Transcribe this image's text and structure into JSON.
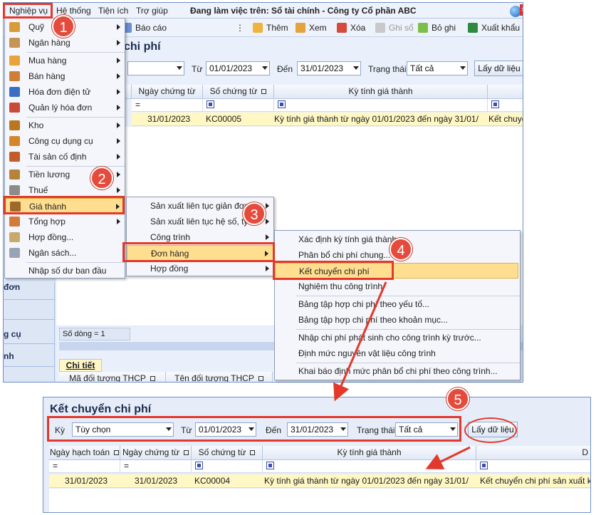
{
  "menubar": {
    "items": [
      "Nghiệp vụ",
      "Hệ thống",
      "Tiện ích",
      "Trợ giúp"
    ],
    "title": "Đang làm việc trên: Sổ tài chính - Công ty Cổ phần ABC"
  },
  "toolbar": {
    "report": "Báo cáo",
    "add": "Thêm",
    "view": "Xem",
    "delete": "Xóa",
    "post": "Ghi sổ",
    "unpost": "Bỏ ghi",
    "export": "Xuất khẩu"
  },
  "left_nav": {
    "items": [
      "đơn",
      "g cụ",
      "nh"
    ]
  },
  "screen_top": {
    "title": "chi phí",
    "from_label": "Từ",
    "from_value": "01/01/2023",
    "to_label": "Đến",
    "to_value": "31/01/2023",
    "status_label": "Trạng thái",
    "status_value": "Tất cả",
    "load_button": "Lấy dữ liệu",
    "columns": [
      "Ngày chứng từ",
      "Số chứng từ",
      "Kỳ tính giá thành"
    ],
    "filter_eq": "=",
    "row": {
      "voucher_date": "31/01/2023",
      "voucher_no": "KC00005",
      "period": "Kỳ tính giá thành từ ngày 01/01/2023 đến ngày 31/01/",
      "desc": "Kết chuyể"
    },
    "row_count": "Số dòng = 1",
    "detail_tab": "Chi tiết",
    "detail_columns": [
      "Mã đối tượng THCP",
      "Tên đối tượng THCP"
    ]
  },
  "menu1": {
    "items": [
      "Quỹ",
      "Ngân hàng",
      "Mua hàng",
      "Bán hàng",
      "Hóa đơn điện tử",
      "Quản lý hóa đơn",
      "Kho",
      "Công cụ dụng cụ",
      "Tài sản cố định",
      "Tiền lương",
      "Thuế",
      "Giá thành",
      "Tổng hợp",
      "Hợp đồng...",
      "Ngân sách...",
      "Nhập số dư ban đầu"
    ]
  },
  "menu2": {
    "items": [
      "Sản xuất liên tục giản đơn",
      "Sản xuất liên tục hệ số, tỷ lệ",
      "Công trình",
      "Đơn hàng",
      "Hợp đồng"
    ]
  },
  "menu3": {
    "items": [
      "Xác định kỳ tính giá thành",
      "Phân bổ chi phí chung...",
      "Kết chuyển chi phí",
      "Nghiệm thu công trình",
      "Bảng tập hợp chi phí theo yếu tố...",
      "Bảng tập hợp chi phí theo khoản mục...",
      "Nhập chi phí phát sinh cho công trình kỳ trước...",
      "Định mức nguyên vật liệu công trình",
      "Khai báo định mức phân bổ chi phí theo công trình..."
    ]
  },
  "badges": [
    "1",
    "2",
    "3",
    "4",
    "5"
  ],
  "screen_bottom": {
    "title": "Kết chuyển chi phí",
    "period_label": "Kỳ",
    "period_value": "Tùy chọn",
    "from_label": "Từ",
    "from_value": "01/01/2023",
    "to_label": "Đến",
    "to_value": "31/01/2023",
    "status_label": "Trạng thái",
    "status_value": "Tất cả",
    "load_button": "Lấy dữ liệu",
    "columns": [
      "Ngày hạch toán",
      "Ngày chứng từ",
      "Số chứng từ",
      "Kỳ tính giá thành",
      "D"
    ],
    "filter_eq": "=",
    "row": {
      "posting_date": "31/01/2023",
      "voucher_date": "31/01/2023",
      "voucher_no": "KC00004",
      "period": "Kỳ tính giá thành từ ngày 01/01/2023 đến ngày 31/01/",
      "desc": "Kết chuyển chi phí sản xuất kỳ"
    }
  }
}
